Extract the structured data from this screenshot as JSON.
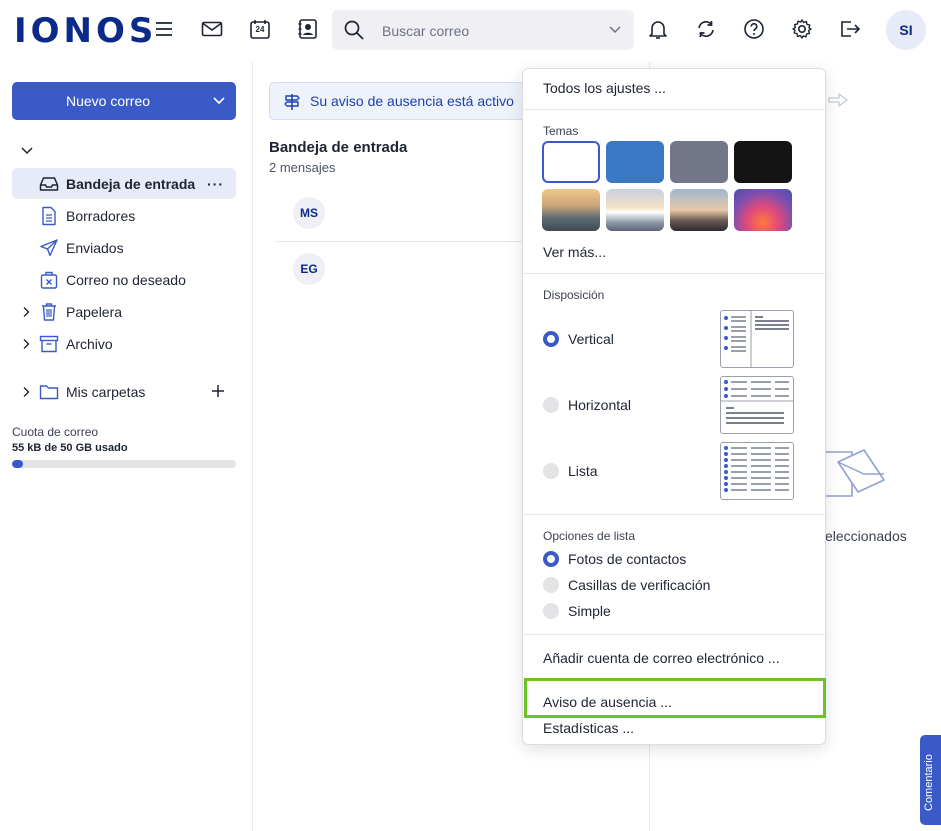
{
  "header": {
    "logo": "IONOS",
    "search_placeholder": "Buscar correo",
    "calendar_day": "24",
    "avatar_initials": "SI"
  },
  "sidebar": {
    "new_mail_label": "Nuevo correo",
    "items": [
      {
        "label": "Bandeja de entrada",
        "icon": "inbox-icon"
      },
      {
        "label": "Borradores",
        "icon": "draft-icon"
      },
      {
        "label": "Enviados",
        "icon": "send-icon"
      },
      {
        "label": "Correo no deseado",
        "icon": "spam-icon"
      },
      {
        "label": "Papelera",
        "icon": "trash-icon"
      },
      {
        "label": "Archivo",
        "icon": "archive-icon"
      },
      {
        "label": "Mis carpetas",
        "icon": "folder-icon"
      }
    ],
    "more_label": "···",
    "quota_label": "Cuota de correo",
    "quota_value": "55 kB de 50 GB usado",
    "quota_fraction": 0.05
  },
  "message_list": {
    "banner": "Su aviso de ausencia está activo",
    "title": "Bandeja de entrada",
    "count": "2 mensajes",
    "messages": [
      {
        "initials": "MS"
      },
      {
        "initials": "EG"
      }
    ]
  },
  "reading_pane": {
    "empty_text_partial": "eleccionados"
  },
  "feedback_label": "Comentario",
  "settings_menu": {
    "all_settings": "Todos los ajustes ...",
    "themes_label": "Temas",
    "theme_colors": [
      "#ffffff",
      "#3b78c4",
      "#74778a",
      "#141414"
    ],
    "see_more": "Ver más...",
    "layout_label": "Disposición",
    "layouts": [
      "Vertical",
      "Horizontal",
      "Lista"
    ],
    "list_options_label": "Opciones de lista",
    "list_options": [
      "Fotos de contactos",
      "Casillas de verificación",
      "Simple"
    ],
    "add_account": "Añadir cuenta de correo electrónico ...",
    "out_of_office": "Aviso de ausencia ...",
    "statistics": "Estadísticas ...",
    "accent_color": "#3a5bc7",
    "highlight_color": "#6bc425"
  }
}
